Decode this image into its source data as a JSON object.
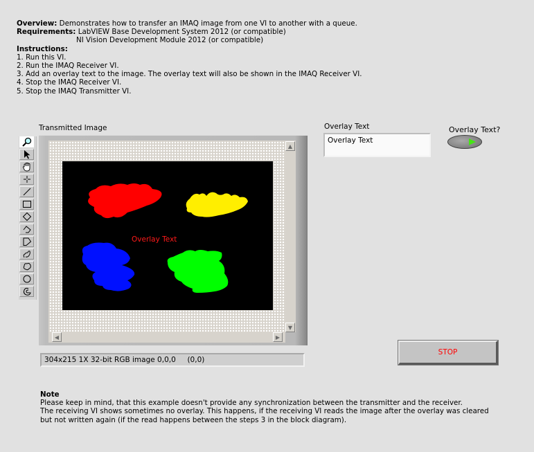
{
  "description": {
    "overview_label": "Overview:",
    "overview_text": "Demonstrates how to transfer an IMAQ image from one VI to another with a queue.",
    "requirements_label": "Requirements:",
    "requirements": [
      "LabVIEW Base Development System 2012 (or compatible)",
      "NI Vision Development Module 2012 (or compatible)"
    ],
    "instructions_label": "Instructions:",
    "instructions": [
      "1. Run this VI.",
      "2. Run the IMAQ Receiver VI.",
      "3. Add an overlay text to the image. The overlay text will also be shown in the IMAQ Receiver VI.",
      "4. Stop the IMAQ Receiver VI.",
      "5. Stop the IMAQ Transmitter VI."
    ]
  },
  "image_display": {
    "label": "Transmitted Image",
    "tools": [
      {
        "name": "zoom-tool",
        "active": true
      },
      {
        "name": "pointer-tool"
      },
      {
        "name": "pan-tool"
      },
      {
        "name": "point-tool"
      },
      {
        "name": "line-tool"
      },
      {
        "name": "rectangle-tool"
      },
      {
        "name": "rotated-rectangle-tool"
      },
      {
        "name": "annulus-tool"
      },
      {
        "name": "polygon-tool"
      },
      {
        "name": "freehand-line-tool"
      },
      {
        "name": "freehand-region-tool"
      },
      {
        "name": "oval-tool"
      },
      {
        "name": "broken-annulus-tool"
      }
    ],
    "overlay_text": "Overlay Text",
    "blobs": [
      {
        "name": "red-blob",
        "color": "#ff0000"
      },
      {
        "name": "yellow-blob",
        "color": "#ffee00"
      },
      {
        "name": "blue-blob",
        "color": "#0010ff"
      },
      {
        "name": "green-blob",
        "color": "#00ff00"
      }
    ],
    "status_bar": "304x215 1X 32-bit RGB image 0,0,0     (0,0)"
  },
  "overlay_control": {
    "label": "Overlay Text",
    "value": "Overlay Text"
  },
  "overlay_toggle": {
    "label": "Overlay Text?",
    "state": "on",
    "on_color": "#45e515"
  },
  "stop_button": {
    "label": "STOP",
    "text_color": "#ff0000"
  },
  "note": {
    "title": "Note",
    "lines": [
      "Please keep in mind, that this example doesn't provide any synchronization between the transmitter and the receiver.",
      "The receiving VI shows sometimes no overlay. This happens, if the receiving VI reads the image after the overlay was cleared",
      "but not written again (if the read happens between the steps 3 in the block diagram)."
    ]
  }
}
